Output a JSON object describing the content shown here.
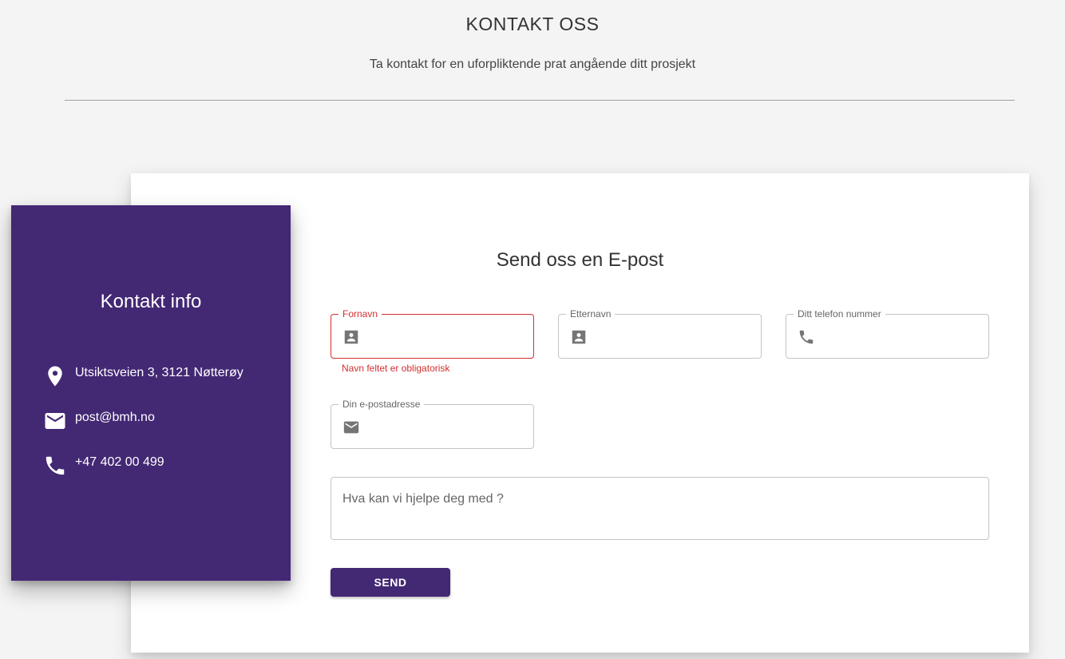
{
  "header": {
    "title": "KONTAKT OSS",
    "subtitle": "Ta kontakt for en uforpliktende prat angående ditt prosjekt"
  },
  "contact_info": {
    "title": "Kontakt info",
    "items": [
      {
        "icon": "location-pin-icon",
        "text": "Utsiktsveien 3, 3121 Nøtterøy"
      },
      {
        "icon": "mail-icon",
        "text": "post@bmh.no"
      },
      {
        "icon": "phone-icon",
        "text": "+47 402 00 499"
      }
    ],
    "background_color": "#432874"
  },
  "form": {
    "heading": "Send oss en E-post",
    "fields": {
      "first_name": {
        "label": "Fornavn",
        "value": "",
        "icon": "contact-card-icon",
        "error": "Navn feltet er obligatorisk"
      },
      "last_name": {
        "label": "Etternavn",
        "value": "",
        "icon": "contact-card-icon"
      },
      "phone": {
        "label": "Ditt telefon nummer",
        "value": "",
        "icon": "phone-icon"
      },
      "email": {
        "label": "Din e-postadresse",
        "value": "",
        "icon": "mail-icon"
      }
    },
    "message_placeholder": "Hva kan vi hjelpe deg med ?",
    "send_label": "SEND",
    "error_color": "#d32f2f",
    "accent_color": "#432874"
  }
}
